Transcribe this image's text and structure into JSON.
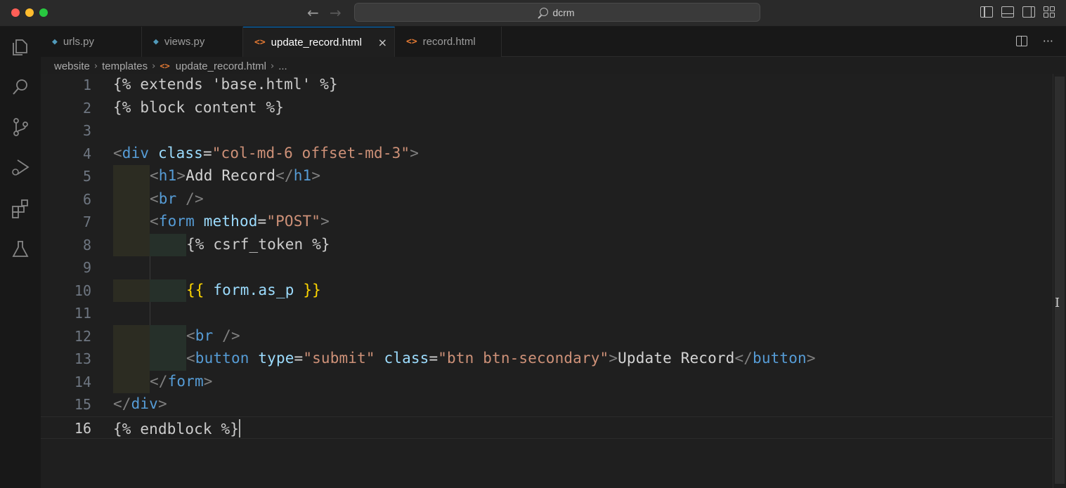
{
  "window": {
    "search_label": "dcrm"
  },
  "tabs": [
    {
      "label": "urls.py",
      "kind": "py",
      "icon": "python-file-icon"
    },
    {
      "label": "views.py",
      "kind": "py",
      "icon": "python-file-icon"
    },
    {
      "label": "update_record.html",
      "kind": "html",
      "icon": "html-file-icon",
      "active": true
    },
    {
      "label": "record.html",
      "kind": "html",
      "icon": "html-file-icon"
    }
  ],
  "tab_close_glyph": "×",
  "breadcrumb": {
    "items": [
      "website",
      "templates",
      "update_record.html",
      "..."
    ],
    "separator": "›"
  },
  "editor": {
    "current_line": 16,
    "lines": [
      {
        "number": "1"
      },
      {
        "number": "2"
      },
      {
        "number": "3"
      },
      {
        "number": "4"
      },
      {
        "number": "5"
      },
      {
        "number": "6"
      },
      {
        "number": "7"
      },
      {
        "number": "8"
      },
      {
        "number": "9"
      },
      {
        "number": "10"
      },
      {
        "number": "11"
      },
      {
        "number": "12"
      },
      {
        "number": "13"
      },
      {
        "number": "14"
      },
      {
        "number": "15"
      },
      {
        "number": "16"
      }
    ],
    "code": {
      "l1": "{% extends 'base.html' %}",
      "l2": "{% block content %}",
      "l4_open": "<",
      "l4_tag": "div",
      "l4_attr": "class",
      "l4_eq": "=",
      "l4_val": "\"col-md-6 offset-md-3\"",
      "l4_close": ">",
      "l5_lt": "<",
      "l5_tag": "h1",
      "l5_gt": ">",
      "l5_text": "Add Record",
      "l5_lt2": "</",
      "l5_tag2": "h1",
      "l5_gt2": ">",
      "l6_lt": "<",
      "l6_tag": "br",
      "l6_end": " />",
      "l7_lt": "<",
      "l7_tag": "form",
      "l7_attr": "method",
      "l7_eq": "=",
      "l7_val": "\"POST\"",
      "l7_gt": ">",
      "l8": "{% csrf_token %}",
      "l10_open": "{{",
      "l10_var": " form.as_p ",
      "l10_close": "}}",
      "l12_lt": "<",
      "l12_tag": "br",
      "l12_end": " />",
      "l13_lt": "<",
      "l13_tag": "button",
      "l13_attr1": "type",
      "l13_eq1": "=",
      "l13_val1": "\"submit\"",
      "l13_attr2": "class",
      "l13_eq2": "=",
      "l13_val2": "\"btn btn-secondary\"",
      "l13_gt": ">",
      "l13_text": "Update Record",
      "l13_lt2": "</",
      "l13_tag2": "button",
      "l13_gt2": ">",
      "l14_lt": "</",
      "l14_tag": "form",
      "l14_gt": ">",
      "l15_lt": "</",
      "l15_tag": "div",
      "l15_gt": ">",
      "l16": "{% endblock %}"
    }
  },
  "colors": {
    "accent": "#0078d4",
    "tag": "#569cd6",
    "attribute": "#9cdcfe",
    "string": "#ce9178",
    "template_brace": "#ffd700"
  }
}
